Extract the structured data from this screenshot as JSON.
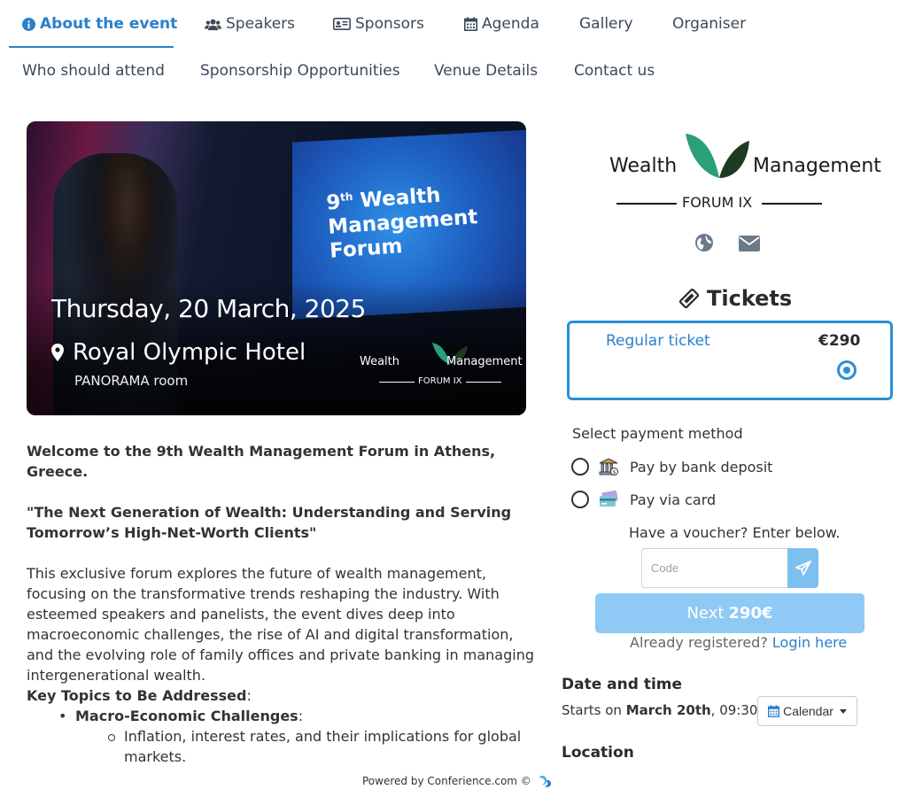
{
  "nav": {
    "row1": [
      {
        "label": "About the event",
        "icon": "info-circle-icon",
        "active": true
      },
      {
        "label": "Speakers",
        "icon": "users-icon"
      },
      {
        "label": "Sponsors",
        "icon": "id-card-icon"
      },
      {
        "label": "Agenda",
        "icon": "calendar-icon"
      },
      {
        "label": "Gallery"
      },
      {
        "label": "Organiser"
      }
    ],
    "row2": [
      {
        "label": "Who should attend"
      },
      {
        "label": "Sponsorship Opportunities"
      },
      {
        "label": "Venue Details"
      },
      {
        "label": "Contact us"
      }
    ]
  },
  "hero": {
    "screen_sup": "th",
    "screen_line1": "9",
    "screen_line1b": " Wealth",
    "screen_line2": "Management",
    "screen_line3": "Forum",
    "date": "Thursday, 20 March, 2025",
    "venue": "Royal Olympic Hotel",
    "room": "PANORAMA room",
    "logo_left": "Wealth",
    "logo_right": "Management",
    "logo_sub": "FORUM IX"
  },
  "content": {
    "welcome": "Welcome to the 9th Wealth Management Forum in Athens, Greece.",
    "quote": "\"The Next Generation of Wealth: Understanding and Serving Tomorrow’s High-Net-Worth Clients\"",
    "paragraph": "This exclusive forum explores the future of wealth management, focusing on the transformative trends reshaping the industry. With esteemed speakers and panelists, the event dives deep into macroeconomic challenges, the rise of AI and digital transformation, and the evolving role of family offices and private banking in managing intergenerational wealth.",
    "key_topics_title": "Key Topics to Be Addressed",
    "key_topics_colon": ":",
    "topic1": "Macro-Economic Challenges",
    "topic1_colon": ":",
    "subtopic1": "Inflation, interest rates, and their implications for global markets."
  },
  "footer": {
    "powered": "Powered by Conferience.com ©"
  },
  "logo": {
    "left": "Wealth",
    "right": "Management",
    "sub": "FORUM IX"
  },
  "tickets": {
    "title": "Tickets",
    "ticket_name": "Regular ticket",
    "ticket_price": "€290",
    "selected": true
  },
  "payment": {
    "label": "Select payment method",
    "options": [
      {
        "label": "Pay by bank deposit",
        "icon": "bank-icon"
      },
      {
        "label": "Pay via card",
        "icon": "credit-card-icon"
      }
    ]
  },
  "voucher": {
    "label": "Have a voucher? Enter below.",
    "placeholder": "Code",
    "value": ""
  },
  "next": {
    "label": "Next",
    "amount": "290€"
  },
  "registered": {
    "text": "Already registered?",
    "link": "Login here"
  },
  "datetime": {
    "title": "Date and time",
    "starts_prefix": "Starts on",
    "starts_date": "March 20th",
    "starts_time": ", 09:30",
    "calendar_label": "Calendar"
  },
  "location": {
    "title": "Location"
  },
  "colors": {
    "accent": "#2a80c9",
    "ticket_border": "#2a8fd8",
    "next_button": "#8fc9f5",
    "voucher_button": "#7cc0f0"
  }
}
